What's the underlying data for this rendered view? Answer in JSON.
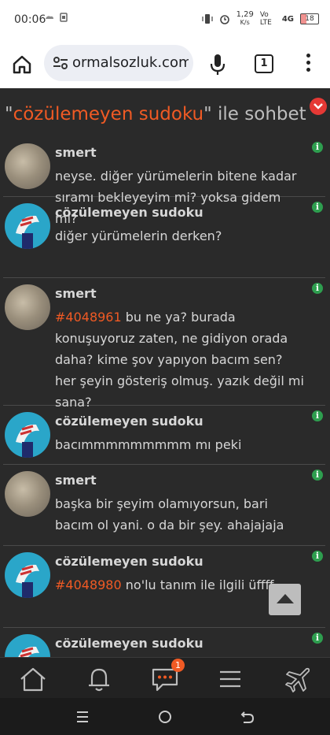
{
  "status_bar": {
    "time": "00:06",
    "network_speed": "1,29",
    "network_unit": "K/s",
    "lte": "Vo LTE",
    "signal": "4G",
    "battery": "18"
  },
  "browser": {
    "url": "ormalsozluk.com",
    "tab_count": "1"
  },
  "page": {
    "title_prefix": "\"",
    "title_highlight": "cözülemeyen sudoku",
    "title_suffix": "\" ile sohbet"
  },
  "messages": [
    {
      "author": "smert",
      "avatar": "smert",
      "ref": "",
      "text": "neyse. diğer yürümelerin bitene kadar sıramı bekleyeyim mi? yoksa gidem mi?"
    },
    {
      "author": "cözülemeyen sudoku",
      "avatar": "sudoku",
      "ref": "",
      "text": "diğer yürümelerin derken?"
    },
    {
      "author": "smert",
      "avatar": "smert",
      "ref": "#4048961",
      "text": " bu ne ya? burada konuşuyoruz zaten, ne gidiyon orada daha? kime şov yapıyon bacım sen? her şeyin gösteriş olmuş. yazık değil mi sana?"
    },
    {
      "author": "cözülemeyen sudoku",
      "avatar": "sudoku",
      "ref": "",
      "text": "bacımmmmmmmmm mı peki"
    },
    {
      "author": "smert",
      "avatar": "smert",
      "ref": "",
      "text": "başka bir şeyim olamıyorsun, bari bacım ol yani. o da bir şey. ahajajaja"
    },
    {
      "author": "cözülemeyen sudoku",
      "avatar": "sudoku",
      "ref": "#4048980",
      "text": " no'lu tanım ile ilgili üffff"
    },
    {
      "author": "cözülemeyen sudoku",
      "avatar": "sudoku",
      "ref": "",
      "text": ""
    }
  ],
  "bottom_nav": {
    "messages_badge": "1"
  },
  "icons": {
    "home": "home-icon",
    "bell": "bell-icon",
    "messages": "chat-bubble-icon",
    "menu": "hamburger-icon",
    "travel": "airplane-icon"
  },
  "colors": {
    "accent": "#f05a24",
    "background": "#2a2a2a",
    "text": "#d7d7d7",
    "info": "#2e9e4f"
  }
}
